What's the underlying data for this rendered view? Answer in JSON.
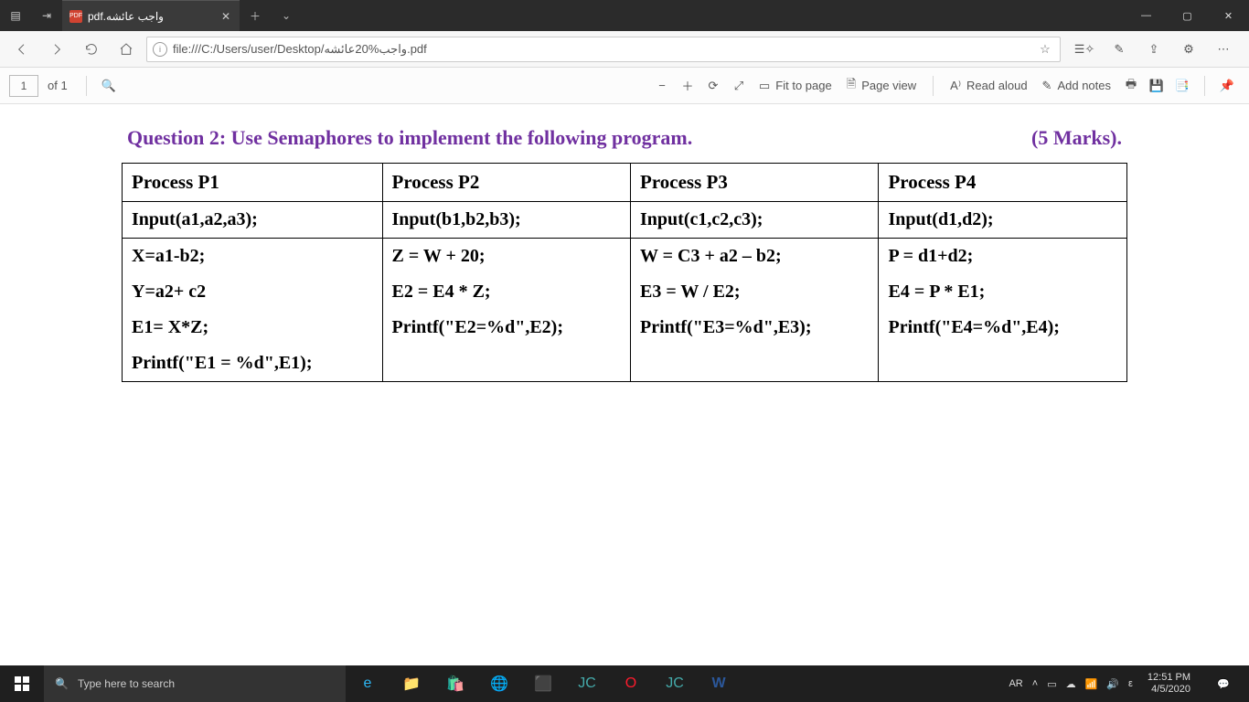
{
  "titlebar": {
    "tab_label": "pdf.واجب عائشه",
    "pdf_badge": "PDF"
  },
  "address": {
    "url": "file:///C:/Users/user/Desktop/واجب%20عائشه.pdf"
  },
  "pdftool": {
    "page_current": "1",
    "page_of": "of 1",
    "fit": "Fit to page",
    "pageview": "Page view",
    "readaloud": "Read aloud",
    "addnotes": "Add notes"
  },
  "doc": {
    "question_left": "Question 2: Use Semaphores to implement the following program.",
    "question_right": "(5 Marks).",
    "rows": [
      [
        "Process P1",
        "Process P2",
        "Process P3",
        "Process P4"
      ],
      [
        "Input(a1,a2,a3);",
        "Input(b1,b2,b3);",
        "Input(c1,c2,c3);",
        "Input(d1,d2);"
      ],
      [
        "X=a1-b2;",
        "Z = W + 20;",
        "W = C3 + a2 – b2;",
        "P = d1+d2;"
      ],
      [
        "Y=a2+ c2",
        "E2 = E4 * Z;",
        "E3 = W / E2;",
        "E4 = P * E1;"
      ],
      [
        "E1= X*Z;",
        "Printf(\"E2=%d\",E2);",
        "Printf(\"E3=%d\",E3);",
        "Printf(\"E4=%d\",E4);"
      ],
      [
        "Printf(\"E1 = %d\",E1);",
        "",
        "",
        ""
      ]
    ]
  },
  "taskbar": {
    "search_placeholder": "Type here to search",
    "lang": "AR",
    "ime": "ε",
    "time": "12:51 PM",
    "date": "4/5/2020"
  }
}
